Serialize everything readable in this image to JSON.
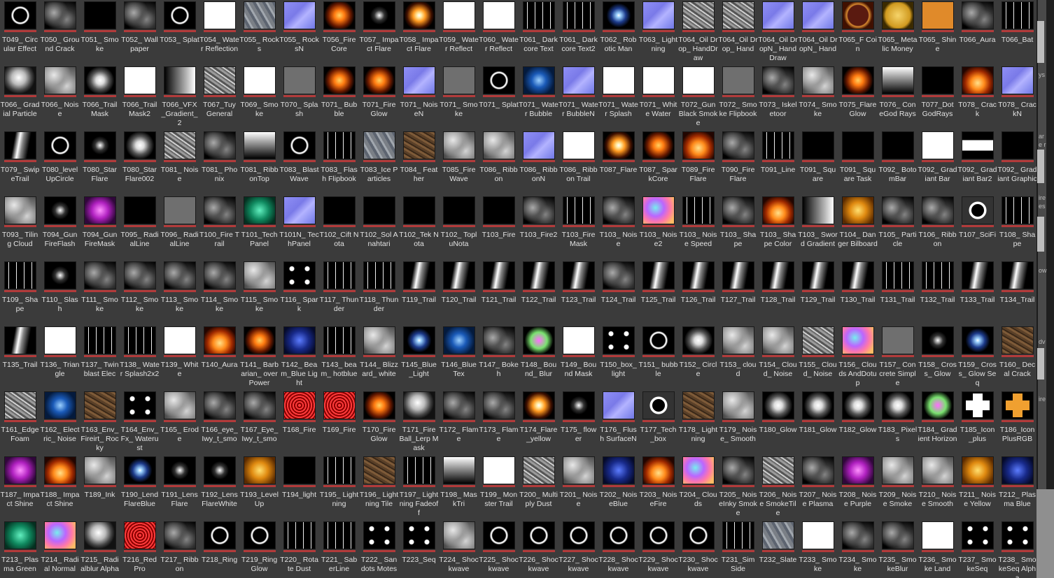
{
  "tiles": [
    {
      "label": "T049_ Circular Effect",
      "look": "ring"
    },
    {
      "label": "T050_ Ground Crack",
      "look": "smoke"
    },
    {
      "label": "T051_ Smoke",
      "look": "black"
    },
    {
      "label": "T052_ Wallpaper",
      "look": "smoke"
    },
    {
      "label": "T053_ Splat",
      "look": "ring"
    },
    {
      "label": "T054_ Water Reflection",
      "look": "white"
    },
    {
      "label": "T055_ Rocks",
      "look": "rocks"
    },
    {
      "label": "T055_ RocksN",
      "look": "normal"
    },
    {
      "label": "T056_Fire Core",
      "look": "orange"
    },
    {
      "label": "T057_ Impact Flare",
      "look": "star"
    },
    {
      "label": "T058_ Impact Flare",
      "look": "flash"
    },
    {
      "label": "T059_ Water Reflect",
      "look": "white"
    },
    {
      "label": "T060_ Water Reflect",
      "look": "white"
    },
    {
      "label": "T061_ Darkcore Text",
      "look": "streak"
    },
    {
      "label": "T061_ Darkcore Text2",
      "look": "streak"
    },
    {
      "label": "T062_ Robotic Man",
      "look": "bluestar"
    },
    {
      "label": "T063_ Lightning",
      "look": "normal"
    },
    {
      "label": "T064_Oil Drop_ HandDraw",
      "look": "noise"
    },
    {
      "label": "T064_Oil Drop_ Hand",
      "look": "noise"
    },
    {
      "label": "T064_Oil DropN_ HandDraw",
      "look": "normal"
    },
    {
      "label": "T064_Oil DropN_ Hand",
      "look": "normal"
    },
    {
      "label": "T065_F Coin",
      "look": "fcoin"
    },
    {
      "label": "T065_ Metalic Money",
      "look": "coin"
    },
    {
      "label": "T065_ Shine",
      "look": "shine"
    },
    {
      "label": "T066_Aura",
      "look": "smoke"
    },
    {
      "label": "T066_Bat",
      "look": "streak"
    },
    {
      "label": "T066_ Gradial Particle",
      "look": "ball"
    },
    {
      "label": "T066_ Noise",
      "look": "cloud"
    },
    {
      "label": "T066_Trail Mask",
      "look": "glow"
    },
    {
      "label": "T066_Trail Mask2",
      "look": "white"
    },
    {
      "label": "T066_VFX _Gradient_ 2",
      "look": "gradv"
    },
    {
      "label": "T067_Tuy General",
      "look": "noise"
    },
    {
      "label": "T069_ Smoke",
      "look": "white"
    },
    {
      "label": "T070_ Splash",
      "look": "gray"
    },
    {
      "label": "T071_ Bubble",
      "look": "orange"
    },
    {
      "label": "T071_Fire Glow",
      "look": "orange"
    },
    {
      "label": "T071_ NoiseN",
      "look": "normal"
    },
    {
      "label": "T071_ Smoke",
      "look": "gray"
    },
    {
      "label": "T071_ Splat",
      "look": "ring"
    },
    {
      "label": "T071_ Water Bubble",
      "look": "electric"
    },
    {
      "label": "T071_ Water BubbleN",
      "look": "normal"
    },
    {
      "label": "T071_ Water Splash",
      "look": "white"
    },
    {
      "label": "T071_ White Water",
      "look": "white"
    },
    {
      "label": "T072_Gun Black Smoke",
      "look": "white"
    },
    {
      "label": "T072_ Smoke Flipbook",
      "look": "gray"
    },
    {
      "label": "T073_ Iskeletoor",
      "look": "smoke"
    },
    {
      "label": "T074_ Smoke",
      "look": "cloud"
    },
    {
      "label": "T075_Flare Glow",
      "look": "orange"
    },
    {
      "label": "T076_ ConeGod Rays",
      "look": "gradh"
    },
    {
      "label": "T077_Dot GodRays",
      "look": "black"
    },
    {
      "label": "T078_ Crack",
      "look": "fire"
    },
    {
      "label": "T078_ CrackN",
      "look": "normal"
    },
    {
      "label": "T079_ SwipeTrail",
      "look": "trail"
    },
    {
      "label": "T080_level UpCircle",
      "look": "ring"
    },
    {
      "label": "T080_Star Flare",
      "look": "star"
    },
    {
      "label": "T080_Star Flare002",
      "look": "glow"
    },
    {
      "label": "T081_ Noise",
      "look": "noise"
    },
    {
      "label": "T081_ Phonix",
      "look": "smoke"
    },
    {
      "label": "T081_ RibbonTop",
      "look": "gradh"
    },
    {
      "label": "T083_ BlastWave",
      "look": "ring"
    },
    {
      "label": "T083_ Flash Flipbook",
      "look": "streak"
    },
    {
      "label": "T083_Ice Particles",
      "look": "rocks"
    },
    {
      "label": "T084_ Feather",
      "look": "brown"
    },
    {
      "label": "T085_Fire Wave",
      "look": "cloud"
    },
    {
      "label": "T086_ Ribbon",
      "look": "cloud"
    },
    {
      "label": "T086_ RibbonN",
      "look": "normal"
    },
    {
      "label": "T086_ Ribbon Trail",
      "look": "white"
    },
    {
      "label": "T087_Flare",
      "look": "flash"
    },
    {
      "label": "T087_ SparkCore",
      "look": "orange"
    },
    {
      "label": "T089_Fire Flare",
      "look": "fire"
    },
    {
      "label": "T090_Fire Flare",
      "look": "smoke"
    },
    {
      "label": "T091_Line",
      "look": "streak"
    },
    {
      "label": "T091_ Square",
      "look": "black"
    },
    {
      "label": "T091_ Square Task",
      "look": "black"
    },
    {
      "label": "T092_ BotomBar",
      "look": "black"
    },
    {
      "label": "T092_ Gradiant Bar",
      "look": "white"
    },
    {
      "label": "T092_ Gradiant Bar2",
      "look": "sq"
    },
    {
      "label": "T092_ Gradiant Graphic",
      "look": "black"
    },
    {
      "label": "T093_ Tiling Cloud",
      "look": "cloud"
    },
    {
      "label": "T094_Gun FireFlash",
      "look": "star"
    },
    {
      "label": "T094_Gun FireMask",
      "look": "purple"
    },
    {
      "label": "T095_ RadialLine",
      "look": "black"
    },
    {
      "label": "T096_ RadialLine",
      "look": "gray"
    },
    {
      "label": "T100_Fire Trail",
      "look": "smoke"
    },
    {
      "label": "T101_Tech Panel",
      "look": "green"
    },
    {
      "label": "T101N_ TechPanel",
      "look": "normal"
    },
    {
      "label": "T102_Cift Nota",
      "look": "black"
    },
    {
      "label": "T102_Sol Anahtari",
      "look": "black"
    },
    {
      "label": "T102_Tek Nota",
      "look": "black"
    },
    {
      "label": "T102_ TopluNota",
      "look": "black"
    },
    {
      "label": "T103_Fire",
      "look": "black"
    },
    {
      "label": "T103_Fire2",
      "look": "smoke"
    },
    {
      "label": "T103_Fire Mask",
      "look": "streak"
    },
    {
      "label": "T103_ Noise",
      "look": "smoke"
    },
    {
      "label": "T103_ Noise2",
      "look": "rainbow"
    },
    {
      "label": "T103_ Noise Speed",
      "look": "streak"
    },
    {
      "label": "T103_ Shape",
      "look": "smoke"
    },
    {
      "label": "T103_ Shape Color",
      "look": "fire"
    },
    {
      "label": "T103_ Sword Gradient",
      "look": "gradv"
    },
    {
      "label": "T104_ Danger Bilboard",
      "look": "yellowf"
    },
    {
      "label": "T105_ Particle",
      "look": "smoke"
    },
    {
      "label": "T106_ Ribbon",
      "look": "smoke"
    },
    {
      "label": "T107_SciFi",
      "look": "box"
    },
    {
      "label": "T108_ Shape",
      "look": "streak"
    },
    {
      "label": "T109_ Shape",
      "look": "streak"
    },
    {
      "label": "T110_ Slash",
      "look": "star"
    },
    {
      "label": "T111_ Smoke",
      "look": "smoke"
    },
    {
      "label": "T112_ Smoke",
      "look": "smoke"
    },
    {
      "label": "T113_ Smoke",
      "look": "smoke"
    },
    {
      "label": "T114_ Smoke",
      "look": "smoke"
    },
    {
      "label": "T115_ Smoke",
      "look": "cloud"
    },
    {
      "label": "T116_ Spark",
      "look": "spots"
    },
    {
      "label": "T117_ Thunder",
      "look": "streak"
    },
    {
      "label": "T118_ Thunder",
      "look": "streak"
    },
    {
      "label": "T119_Trail",
      "look": "trail"
    },
    {
      "label": "T120_Trail",
      "look": "trail"
    },
    {
      "label": "T121_Trail",
      "look": "trail"
    },
    {
      "label": "T122_Trail",
      "look": "trail"
    },
    {
      "label": "T123_Trail",
      "look": "trail"
    },
    {
      "label": "T124_Trail",
      "look": "smoke"
    },
    {
      "label": "T125_Trail",
      "look": "trail"
    },
    {
      "label": "T126_Trail",
      "look": "trail"
    },
    {
      "label": "T127_Trail",
      "look": "trail"
    },
    {
      "label": "T128_Trail",
      "look": "trail"
    },
    {
      "label": "T129_Trail",
      "look": "trail"
    },
    {
      "label": "T130_Trail",
      "look": "trail"
    },
    {
      "label": "T131_Trail",
      "look": "streak"
    },
    {
      "label": "T132_Trail",
      "look": "streak"
    },
    {
      "label": "T133_Trail",
      "look": "trail"
    },
    {
      "label": "T134_Trail",
      "look": "trail"
    },
    {
      "label": "T135_Trail",
      "look": "trail"
    },
    {
      "label": "T136_ Triangle",
      "look": "white"
    },
    {
      "label": "T137_ Twinblast Elec",
      "look": "streak"
    },
    {
      "label": "T138_ Water Splash2x2",
      "look": "streak"
    },
    {
      "label": "T139_ White",
      "look": "white"
    },
    {
      "label": "T140_Aura",
      "look": "fire"
    },
    {
      "label": "T141_ Barbarian_ overPower",
      "look": "orange"
    },
    {
      "label": "T142_ Beam_Blue Light",
      "look": "blueplasma"
    },
    {
      "label": "T143_ beam_ hotblue",
      "look": "streak"
    },
    {
      "label": "T144_ Blizzard_ white",
      "look": "cloud"
    },
    {
      "label": "T145_Blue _Light",
      "look": "bluestar"
    },
    {
      "label": "T146_Blue Tex",
      "look": "electric"
    },
    {
      "label": "T147_ Bokeh",
      "look": "smoke"
    },
    {
      "label": "T148_ Bound_ Blur",
      "look": "glowcross"
    },
    {
      "label": "T149_ Bound Mask",
      "look": "white"
    },
    {
      "label": "T150_box_ light",
      "look": "spots"
    },
    {
      "label": "T151_ bubble",
      "look": "ring"
    },
    {
      "label": "T152_ Circle",
      "look": "glow"
    },
    {
      "label": "T153_ cloud",
      "look": "cloud"
    },
    {
      "label": "T154_ Cloud_ Noise",
      "look": "cloud"
    },
    {
      "label": "T155_ Cloud_ Noise",
      "look": "noise"
    },
    {
      "label": "T156_ Clouds AndDotup",
      "look": "rainbow"
    },
    {
      "label": "T157_ Concrete Simple",
      "look": "gray"
    },
    {
      "label": "T158_ Cross_ Glow",
      "look": "star"
    },
    {
      "label": "T159_ Cross_ Glow Seq",
      "look": "bluestar"
    },
    {
      "label": "T160_ Decal Crack",
      "look": "brown"
    },
    {
      "label": "T161_Edge Foam",
      "look": "noise"
    },
    {
      "label": "T162_ Electric_ Noise",
      "look": "electric"
    },
    {
      "label": "T163_Env_ Fireirt_ Rocky",
      "look": "brown"
    },
    {
      "label": "T164_Env_ Fx_ Waterust",
      "look": "spots"
    },
    {
      "label": "T165_ Erode",
      "look": "cloud"
    },
    {
      "label": "T166_eye_ Iwy_t_smo",
      "look": "smoke"
    },
    {
      "label": "T167_Eye_ Iwy_t_smo",
      "look": "smoke"
    },
    {
      "label": "T168_Fire",
      "look": "red"
    },
    {
      "label": "T169_Fire",
      "look": "red"
    },
    {
      "label": "T170_Fire Glow",
      "look": "orange"
    },
    {
      "label": "T171_Fire Ball_Lerp Mask",
      "look": "ball"
    },
    {
      "label": "T172_ Flame",
      "look": "smoke"
    },
    {
      "label": "T173_ Flame",
      "look": "smoke"
    },
    {
      "label": "T174_Flare _yellow",
      "look": "flash"
    },
    {
      "label": "T175_ flower",
      "look": "star"
    },
    {
      "label": "T176_ Flush SurfaceN",
      "look": "normal"
    },
    {
      "label": "T177_Tech _box",
      "look": "box"
    },
    {
      "label": "T178_ Lightning",
      "look": "brown"
    },
    {
      "label": "T179_ Noise_ Smooth",
      "look": "cloud"
    },
    {
      "label": "T180_Glow",
      "look": "glow"
    },
    {
      "label": "T181_Glow",
      "look": "glow"
    },
    {
      "label": "T182_Glow",
      "look": "glow"
    },
    {
      "label": "T183_ Pixels",
      "look": "glow"
    },
    {
      "label": "T184_ Gradient Horizon",
      "look": "glowcross"
    },
    {
      "label": "T185_Icon _plus",
      "look": "plus"
    },
    {
      "label": "T186_Icon PlusRGB",
      "look": "plusorange"
    },
    {
      "label": "T187_ Impact Shine",
      "look": "purple"
    },
    {
      "label": "T188_ Impact Shine",
      "look": "fire"
    },
    {
      "label": "T189_Ink",
      "look": "cloud"
    },
    {
      "label": "T190_Lend FlareBlue",
      "look": "bluestar"
    },
    {
      "label": "T191_Lens Flare",
      "look": "star"
    },
    {
      "label": "T192_Lens FlareWhite",
      "look": "star"
    },
    {
      "label": "T193_Level Up",
      "look": "yellowf"
    },
    {
      "label": "T194_light",
      "look": "black"
    },
    {
      "label": "T195_ Lightning",
      "look": "streak"
    },
    {
      "label": "T196_ Lightning Tile",
      "look": "brown"
    },
    {
      "label": "T197_ Lightning Fadeoff",
      "look": "streak"
    },
    {
      "label": "T198_ MaskTri",
      "look": "gradh"
    },
    {
      "label": "T199_ Monster Trail",
      "look": "white"
    },
    {
      "label": "T200_ Multiply Dust",
      "look": "noise"
    },
    {
      "label": "T201_ Noise",
      "look": "cloud"
    },
    {
      "label": "T202_ NoiseBlue",
      "look": "blueplasma"
    },
    {
      "label": "T203_ NoiseFire",
      "look": "fire"
    },
    {
      "label": "T204_ Clouds",
      "look": "rainbow"
    },
    {
      "label": "T205_ NoiseInky Smoke",
      "look": "smoke"
    },
    {
      "label": "T206_ Noise SmokeTile",
      "look": "noise"
    },
    {
      "label": "T207_ Noise Plasma",
      "look": "smoke"
    },
    {
      "label": "T208_ Noise Purple",
      "look": "purple"
    },
    {
      "label": "T209_ Noise Smoke",
      "look": "cloud"
    },
    {
      "label": "T210_ Noise Smooth",
      "look": "cloud"
    },
    {
      "label": "T211_ Noise Yellow",
      "look": "yellowf"
    },
    {
      "label": "T212_ Plasma Blue",
      "look": "blueplasma"
    },
    {
      "label": "T213_ Plasma Green",
      "look": "green"
    },
    {
      "label": "T214_ Radial Normal",
      "look": "rainbow"
    },
    {
      "label": "T215_ Radialblur Alpha",
      "look": "ball"
    },
    {
      "label": "T216_Red Pro",
      "look": "red"
    },
    {
      "label": "T217_ Ribbon",
      "look": "smoke"
    },
    {
      "label": "T218_Ring",
      "look": "ring"
    },
    {
      "label": "T219_Ring Glow",
      "look": "ring"
    },
    {
      "label": "T220_ Rotate Dust",
      "look": "streak"
    },
    {
      "label": "T221_ SaberLine",
      "look": "streak"
    },
    {
      "label": "T222_ Sandots Motes",
      "look": "spots"
    },
    {
      "label": "T223_Seq",
      "look": "spots"
    },
    {
      "label": "T224_ Shockwave",
      "look": "cloud"
    },
    {
      "label": "T225_ Shockwave",
      "look": "ring"
    },
    {
      "label": "T226_ Shockwave",
      "look": "ring"
    },
    {
      "label": "T227_ Shockwave",
      "look": "ring"
    },
    {
      "label": "T228_ Shockwave",
      "look": "ring"
    },
    {
      "label": "T229_ Shockwave",
      "look": "ring"
    },
    {
      "label": "T230_ Shockwave",
      "look": "ring"
    },
    {
      "label": "T231_Sim Side",
      "look": "streak"
    },
    {
      "label": "T232_Slate",
      "look": "rocks"
    },
    {
      "label": "T233_ Smoke",
      "look": "white"
    },
    {
      "label": "T234_ Smoke",
      "look": "smoke"
    },
    {
      "label": "T235_ SmokeBlur",
      "look": "smoke"
    },
    {
      "label": "T236_ Smoke Land",
      "look": "white"
    },
    {
      "label": "T237_ SmokeSeq",
      "look": "spots"
    },
    {
      "label": "T238_ SmokeSeq Alpha",
      "look": "spots"
    }
  ],
  "side_panel": {
    "fragments": [
      "ys",
      "ar",
      "e r",
      "ire",
      "es",
      "ow",
      "dv",
      "ire"
    ]
  },
  "colors": {
    "background": "#3b3b3b",
    "asset_bar": "#b23a3a",
    "label_text": "#e2e2e2"
  }
}
